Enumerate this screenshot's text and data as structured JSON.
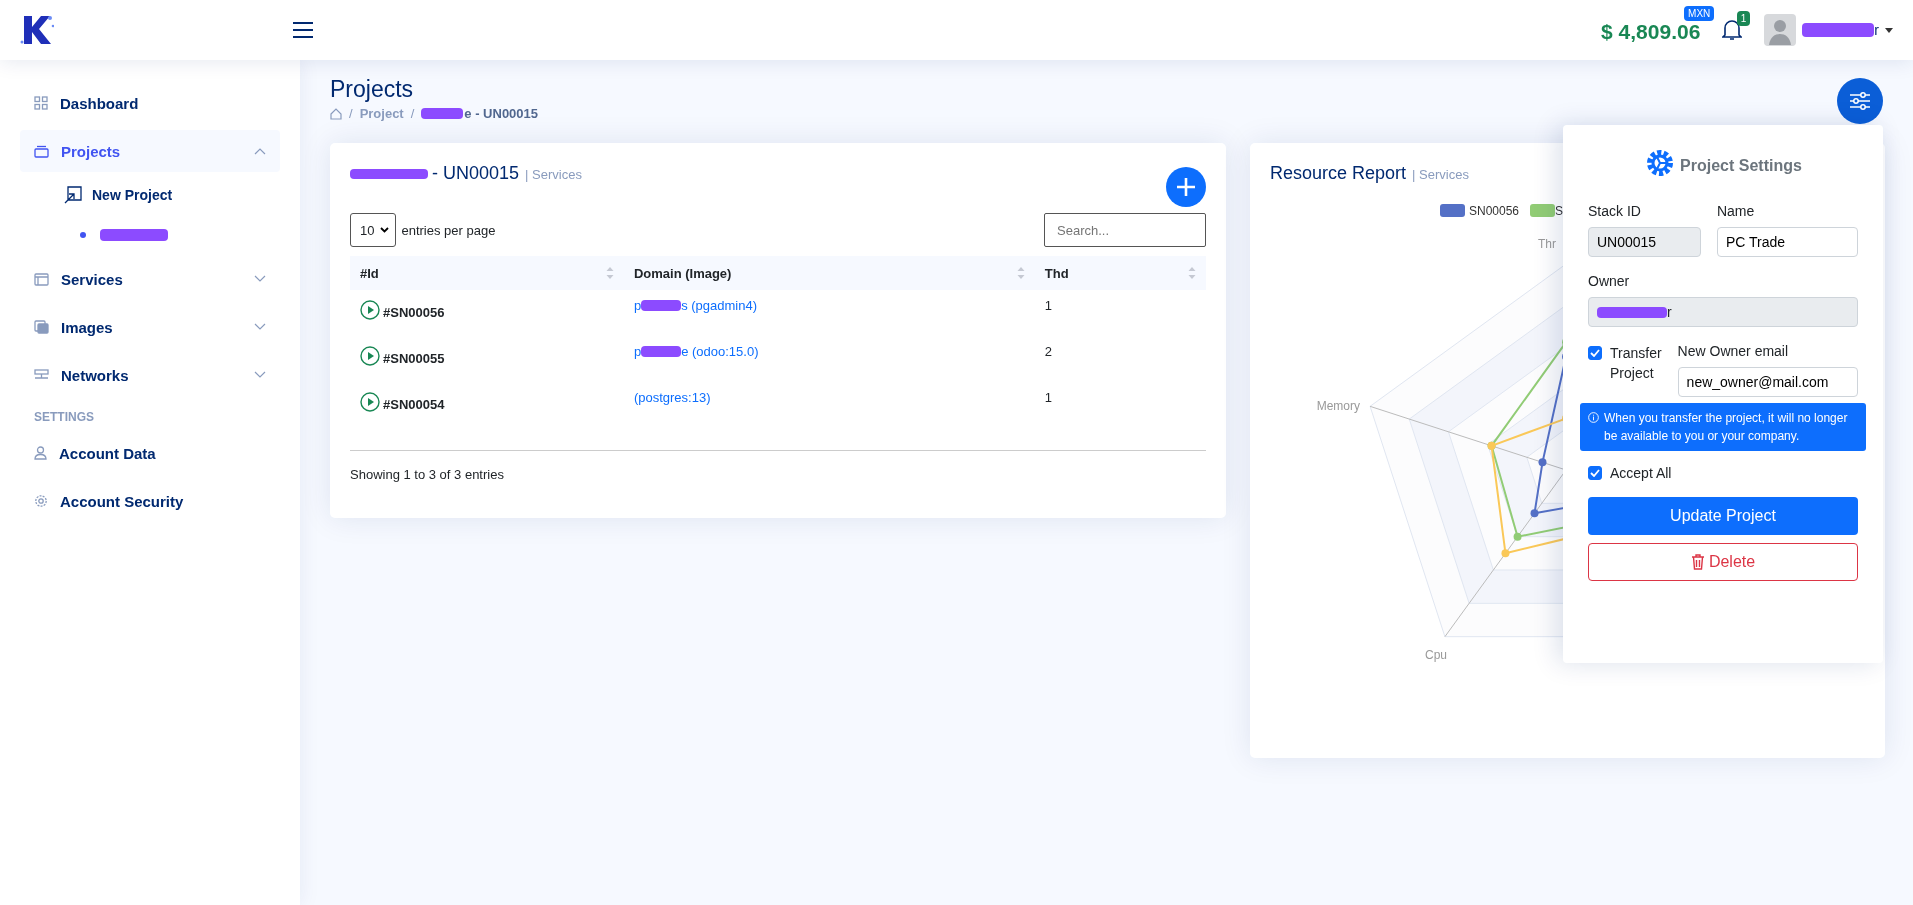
{
  "header": {
    "balance": "$ 4,809.06",
    "currency": "MXN",
    "notifications": "1",
    "user": {
      "name_tail": "r",
      "redacted": true
    }
  },
  "sidebar": {
    "items": [
      {
        "label": "Dashboard",
        "kind": "link",
        "selected": false
      },
      {
        "label": "Projects",
        "kind": "group",
        "selected": true,
        "expanded": true,
        "children": [
          {
            "kind": "link",
            "label": "New Project"
          },
          {
            "kind": "redacted"
          }
        ]
      },
      {
        "label": "Services",
        "kind": "group",
        "selected": false,
        "expanded": false
      },
      {
        "label": "Images",
        "kind": "group",
        "selected": false,
        "expanded": false
      },
      {
        "label": "Networks",
        "kind": "group",
        "selected": false,
        "expanded": false
      }
    ],
    "section_title": "SETTINGS",
    "settings_items": [
      {
        "label": "Account Data",
        "selected": false
      },
      {
        "label": "Account Security",
        "selected": false
      }
    ]
  },
  "page": {
    "title": "Projects",
    "separator": "/",
    "breadcrumb": [
      {
        "kind": "home"
      },
      {
        "kind": "link",
        "label": "Project"
      },
      {
        "kind": "current",
        "label": "e - UN00015",
        "redacted": true
      }
    ]
  },
  "services_card": {
    "title": "- UN00015",
    "title_redacted": true,
    "subtitle": "| Services",
    "page_size": "10",
    "page_size_label": "entries per page",
    "search_placeholder": "Search...",
    "columns": [
      "#Id",
      "Domain (Image)",
      "Thd"
    ],
    "rows": [
      {
        "id": "#SN00056",
        "domain_prefix": "p",
        "domain": "s (pgadmin4)",
        "redacted": true,
        "thd": "1"
      },
      {
        "id": "#SN00055",
        "domain_prefix": "p",
        "domain": "e (odoo:15.0)",
        "redacted": true,
        "thd": "2"
      },
      {
        "id": "#SN00054",
        "domain_prefix": "",
        "domain": "(postgres:13)",
        "redacted": false,
        "thd": "1"
      }
    ],
    "footer": "Showing 1 to 3 of 3 entries"
  },
  "resource_card": {
    "title": "Resource Report",
    "subtitle": "| Services",
    "legend": [
      {
        "name": "SN00056",
        "color": "#5470c6"
      },
      {
        "name": "S",
        "color": "#91cc75"
      }
    ],
    "axes": [
      "Thr",
      "Memory",
      "Cpu"
    ]
  },
  "settings_panel": {
    "title": "Project Settings",
    "stack_id_label": "Stack ID",
    "stack_id": "UN00015",
    "name_label": "Name",
    "name": "PC Trade",
    "owner_label": "Owner",
    "owner": "r",
    "owner_redacted": true,
    "transfer_label": "Transfer Project",
    "transfer_checked": true,
    "email_label": "New Owner email",
    "email": "new_owner@mail.com",
    "notice": "When you transfer the project, it will no longer be available to you or your company.",
    "accept_label": "Accept All",
    "accept_checked": true,
    "update_button": "Update Project",
    "delete_button": "Delete"
  }
}
